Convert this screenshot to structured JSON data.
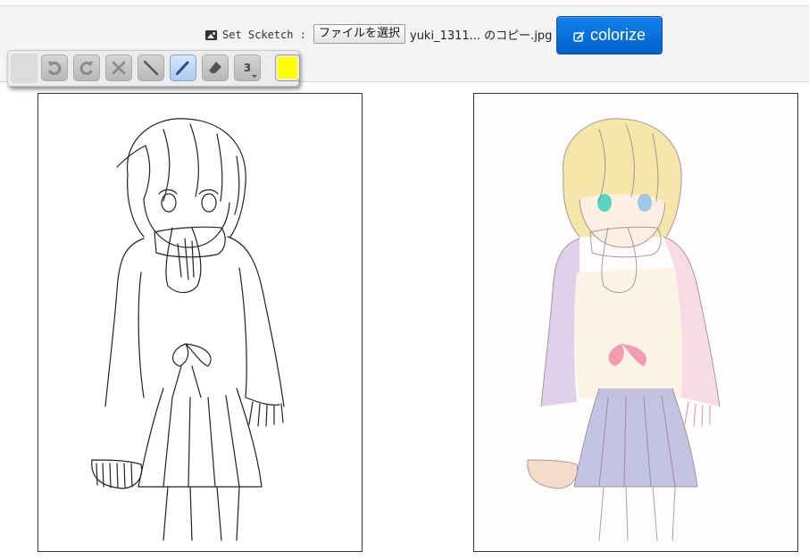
{
  "header": {
    "set_sketch_label": "Set Scketch :",
    "file_button_label": "ファイルを選択",
    "file_name": "yuki_1311... のコピー.jpg",
    "colorize_label": "colorize"
  },
  "toolbar": {
    "tools": [
      {
        "id": "undo",
        "icon": "undo-icon",
        "active": false
      },
      {
        "id": "redo",
        "icon": "redo-icon",
        "active": false
      },
      {
        "id": "clear",
        "icon": "close-icon",
        "active": false
      },
      {
        "id": "line",
        "icon": "line-icon",
        "active": false
      },
      {
        "id": "pen",
        "icon": "pen-icon",
        "active": true
      },
      {
        "id": "eraser",
        "icon": "eraser-icon",
        "active": false
      }
    ],
    "brush_size": "3",
    "current_color": "#ffff00"
  },
  "panels": {
    "sketch": {
      "type": "line-art sketch"
    },
    "result": {
      "type": "colorized image"
    }
  },
  "colors": {
    "accent": "#0a6fdc",
    "header_bg": "#f4f4f4"
  }
}
